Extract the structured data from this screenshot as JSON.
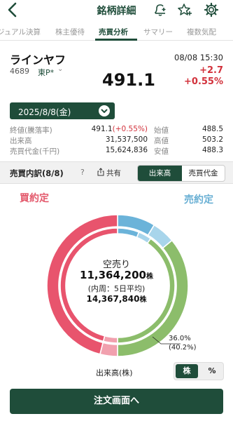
{
  "header": {
    "title": "銘柄詳細",
    "icons": [
      "back-chevron-icon",
      "bell-plus-icon",
      "star-plus-icon",
      "gear-icon"
    ]
  },
  "tabs": [
    {
      "label": "ジュアル決算",
      "active": false
    },
    {
      "label": "株主優待",
      "active": false
    },
    {
      "label": "売買分析",
      "active": true
    },
    {
      "label": "サマリー",
      "active": false
    },
    {
      "label": "複数気配",
      "active": false
    }
  ],
  "stock": {
    "name": "ラインヤフ",
    "code": "4689",
    "market": "東P*",
    "price": "491.1",
    "time": "08/08 15:30",
    "change": "+2.7",
    "change_pct": "+0.55%"
  },
  "date_select": {
    "label": "2025/8/8(金)"
  },
  "stats": {
    "close_label": "終値(騰落率)",
    "close_value": "491.1",
    "close_change": "(+0.55%)",
    "volume_label": "出来高",
    "volume_value": "31,537,500",
    "turnover_label": "売買代金(千円)",
    "turnover_value": "15,624,836",
    "open_label": "始値",
    "open_value": "488.5",
    "high_label": "高値",
    "high_value": "503.2",
    "low_label": "安値",
    "low_value": "488.3"
  },
  "breakdown": {
    "title": "売買内訳(8/8)",
    "help": "?",
    "share_label": "共有",
    "seg_volume": "出来高",
    "seg_value": "売買代金"
  },
  "donut": {
    "buy_label": "買約定",
    "sell_label": "売約定",
    "center_title": "空売り",
    "center_value": "11,364,200",
    "center_unit": "株",
    "center_sub": "(内周：5日平均)",
    "center_value2": "14,367,840",
    "center_unit2": "株",
    "annotation_pct": "36.0%",
    "annotation_avg": "(40.2%)",
    "colors": {
      "buy": "#e8546d",
      "buy_light": "#f1a0ae",
      "sell": "#6bb3d9",
      "sell_light": "#a8d5eb",
      "short": "#8cbd6b"
    }
  },
  "chart_data": {
    "type": "pie",
    "title": "",
    "outer": {
      "name": "",
      "values": [
        {
          "label": "買約定",
          "value": 50.0
        },
        {
          "label": "売約定",
          "value": 14.0
        },
        {
          "label": "",
          "value": 36.0
        }
      ]
    },
    "inner": {
      "name": "",
      "values": [
        {
          "label": "買約定",
          "value": 50.0
        },
        {
          "label": "売約定",
          "value": 9.8
        },
        {
          "label": "",
          "value": 40.2
        }
      ]
    }
  },
  "footer": {
    "unit_label": "出来高(株)",
    "seg_shares": "株",
    "seg_pct": "%",
    "order_button": "注文画面へ"
  }
}
